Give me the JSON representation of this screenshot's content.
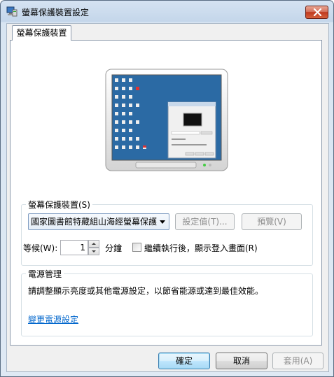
{
  "window": {
    "title": "螢幕保護裝置設定"
  },
  "tabs": [
    {
      "label": "螢幕保護裝置"
    }
  ],
  "screensaver": {
    "group_label": "螢幕保護裝置(S)",
    "selected": "國家圖書館特藏組山海經螢幕保護",
    "settings_button": "設定值(T)...",
    "preview_button": "預覽(V)",
    "wait_label": "等候(W):",
    "wait_value": "1",
    "wait_unit": "分鐘",
    "resume_label": "繼續執行後，顯示登入畫面(R)",
    "resume_checked": false
  },
  "power": {
    "group_label": "電源管理",
    "description": "請調整顯示亮度或其他電源設定，以節省能源或達到最佳效能。",
    "link": "變更電源設定"
  },
  "footer": {
    "ok": "確定",
    "cancel": "取消",
    "apply": "套用(A)"
  },
  "colors": {
    "link": "#0066cc",
    "desktop": "#2b6aa4"
  }
}
